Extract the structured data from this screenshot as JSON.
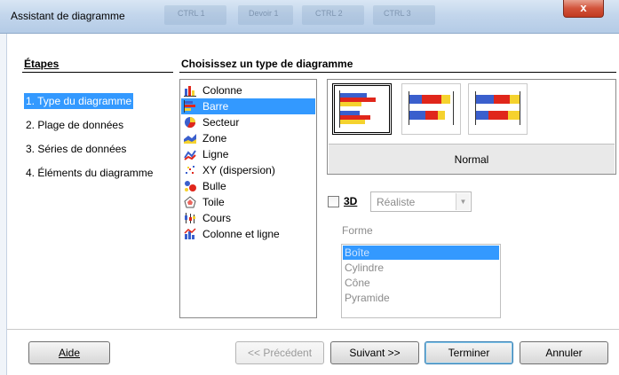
{
  "window": {
    "title": "Assistant de diagramme",
    "close_label": "x",
    "background_ghost_texts": [
      "CTRL 1",
      "Devoir 1",
      "CTRL 2",
      "CTRL 3"
    ]
  },
  "steps": {
    "title": "Étapes",
    "items": [
      {
        "label": "1. Type du diagramme",
        "active": true
      },
      {
        "label": "2. Plage de données",
        "active": false
      },
      {
        "label": "3. Séries de données",
        "active": false
      },
      {
        "label": "4. Éléments du diagramme",
        "active": false
      }
    ]
  },
  "main": {
    "title": "Choisissez un type de diagramme",
    "chart_types": [
      {
        "label": "Colonne",
        "icon": "column-chart-icon"
      },
      {
        "label": "Barre",
        "icon": "bar-chart-icon",
        "selected": true
      },
      {
        "label": "Secteur",
        "icon": "pie-chart-icon"
      },
      {
        "label": "Zone",
        "icon": "area-chart-icon"
      },
      {
        "label": "Ligne",
        "icon": "line-chart-icon"
      },
      {
        "label": "XY (dispersion)",
        "icon": "scatter-chart-icon"
      },
      {
        "label": "Bulle",
        "icon": "bubble-chart-icon"
      },
      {
        "label": "Toile",
        "icon": "net-chart-icon"
      },
      {
        "label": "Cours",
        "icon": "stock-chart-icon"
      },
      {
        "label": "Colonne et ligne",
        "icon": "column-line-chart-icon"
      }
    ],
    "variant_label": "Normal",
    "checkbox_3d": {
      "label": "3D",
      "checked": false
    },
    "style_select": {
      "value": "Réaliste"
    },
    "forme": {
      "label": "Forme",
      "options": [
        "Boîte",
        "Cylindre",
        "Cône",
        "Pyramide"
      ],
      "selected": "Boîte"
    }
  },
  "buttons": {
    "help": "Aide",
    "previous": "<< Précédent",
    "next": "Suivant >>",
    "finish": "Terminer",
    "cancel": "Annuler"
  },
  "colors": {
    "selection": "#3399ff",
    "bar_blue": "#3a5fcd",
    "bar_red": "#e0261b",
    "bar_yellow": "#f5d22e"
  }
}
